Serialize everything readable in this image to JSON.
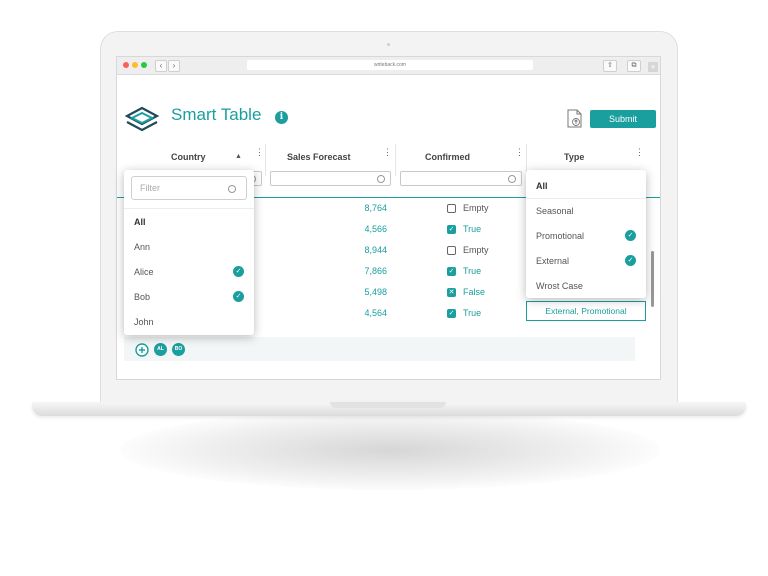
{
  "browser": {
    "url": "writeback.com",
    "back": "‹",
    "forward": "›",
    "share": "⇧",
    "tabs": "⧉",
    "new_tab": "+",
    "dot_colors": [
      "#ff5f57",
      "#febc2e",
      "#28c840"
    ]
  },
  "app": {
    "title": "Smart Table",
    "info_icon": "i",
    "submit_label": "Submit",
    "accent": "#1a9e9e"
  },
  "columns": {
    "country": "Country",
    "sort_glyph": "▲",
    "sales": "Sales Forecast",
    "confirmed": "Confirmed",
    "type": "Type"
  },
  "rows": [
    {
      "sales": "8,764",
      "confirmed": "Empty"
    },
    {
      "sales": "4,566",
      "confirmed": "True"
    },
    {
      "sales": "8,944",
      "confirmed": "Empty"
    },
    {
      "sales": "7,866",
      "confirmed": "True"
    },
    {
      "sales": "5,498",
      "confirmed": "False"
    },
    {
      "sales": "4,564",
      "confirmed": "True"
    }
  ],
  "country_filter": {
    "placeholder": "Filter",
    "items": [
      {
        "label": "All",
        "checked": false
      },
      {
        "label": "Ann",
        "checked": false
      },
      {
        "label": "Alice",
        "checked": true
      },
      {
        "label": "Bob",
        "checked": true
      },
      {
        "label": "John",
        "checked": false
      }
    ]
  },
  "type_filter": {
    "items": [
      {
        "label": "All",
        "checked": false
      },
      {
        "label": "Seasonal",
        "checked": false
      },
      {
        "label": "Promotional",
        "checked": true
      },
      {
        "label": "External",
        "checked": true
      },
      {
        "label": "Wrost Case",
        "checked": false
      }
    ]
  },
  "selected_type_cell": "External, Promotional",
  "footer": {
    "chips": [
      "AL",
      "BO"
    ]
  }
}
